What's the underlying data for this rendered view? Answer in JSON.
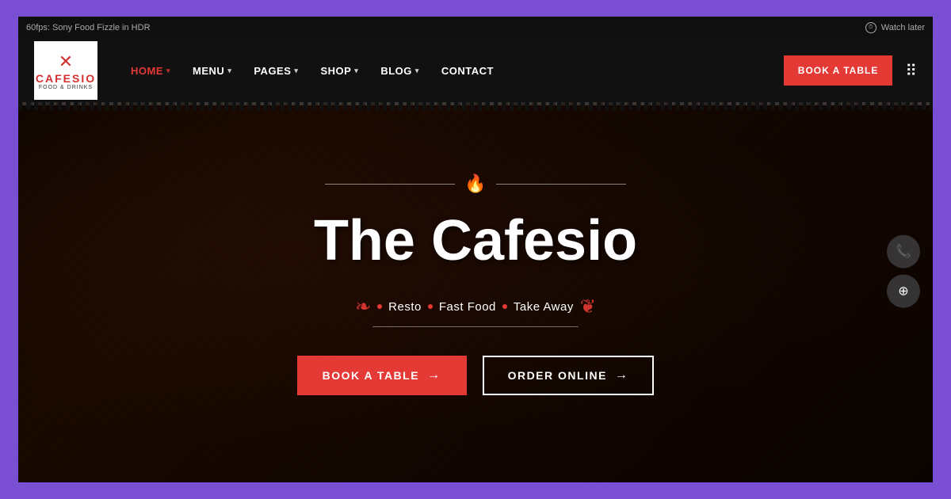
{
  "yt_bar": {
    "video_info": "60fps: Sony Food Fizzle in HDR",
    "watch_later": "Watch later"
  },
  "navbar": {
    "logo": {
      "name": "CAFESIO",
      "sub": "Food & Drinks"
    },
    "nav_items": [
      {
        "label": "HOME",
        "active": true,
        "has_caret": true
      },
      {
        "label": "MENU",
        "active": false,
        "has_caret": true
      },
      {
        "label": "PAGES",
        "active": false,
        "has_caret": true
      },
      {
        "label": "SHOP",
        "active": false,
        "has_caret": true
      },
      {
        "label": "BLOG",
        "active": false,
        "has_caret": true
      },
      {
        "label": "CONTACT",
        "active": false,
        "has_caret": false
      }
    ],
    "book_btn": "BOOK A TABLE"
  },
  "hero": {
    "title": "The Cafesio",
    "tags": [
      "Resto",
      "Fast Food",
      "Take Away"
    ],
    "book_btn": "BOOK A TABLE",
    "order_btn": "ORDER ONLINE"
  },
  "side_actions": {
    "phone_icon": "☎",
    "layers_icon": "⊕"
  }
}
